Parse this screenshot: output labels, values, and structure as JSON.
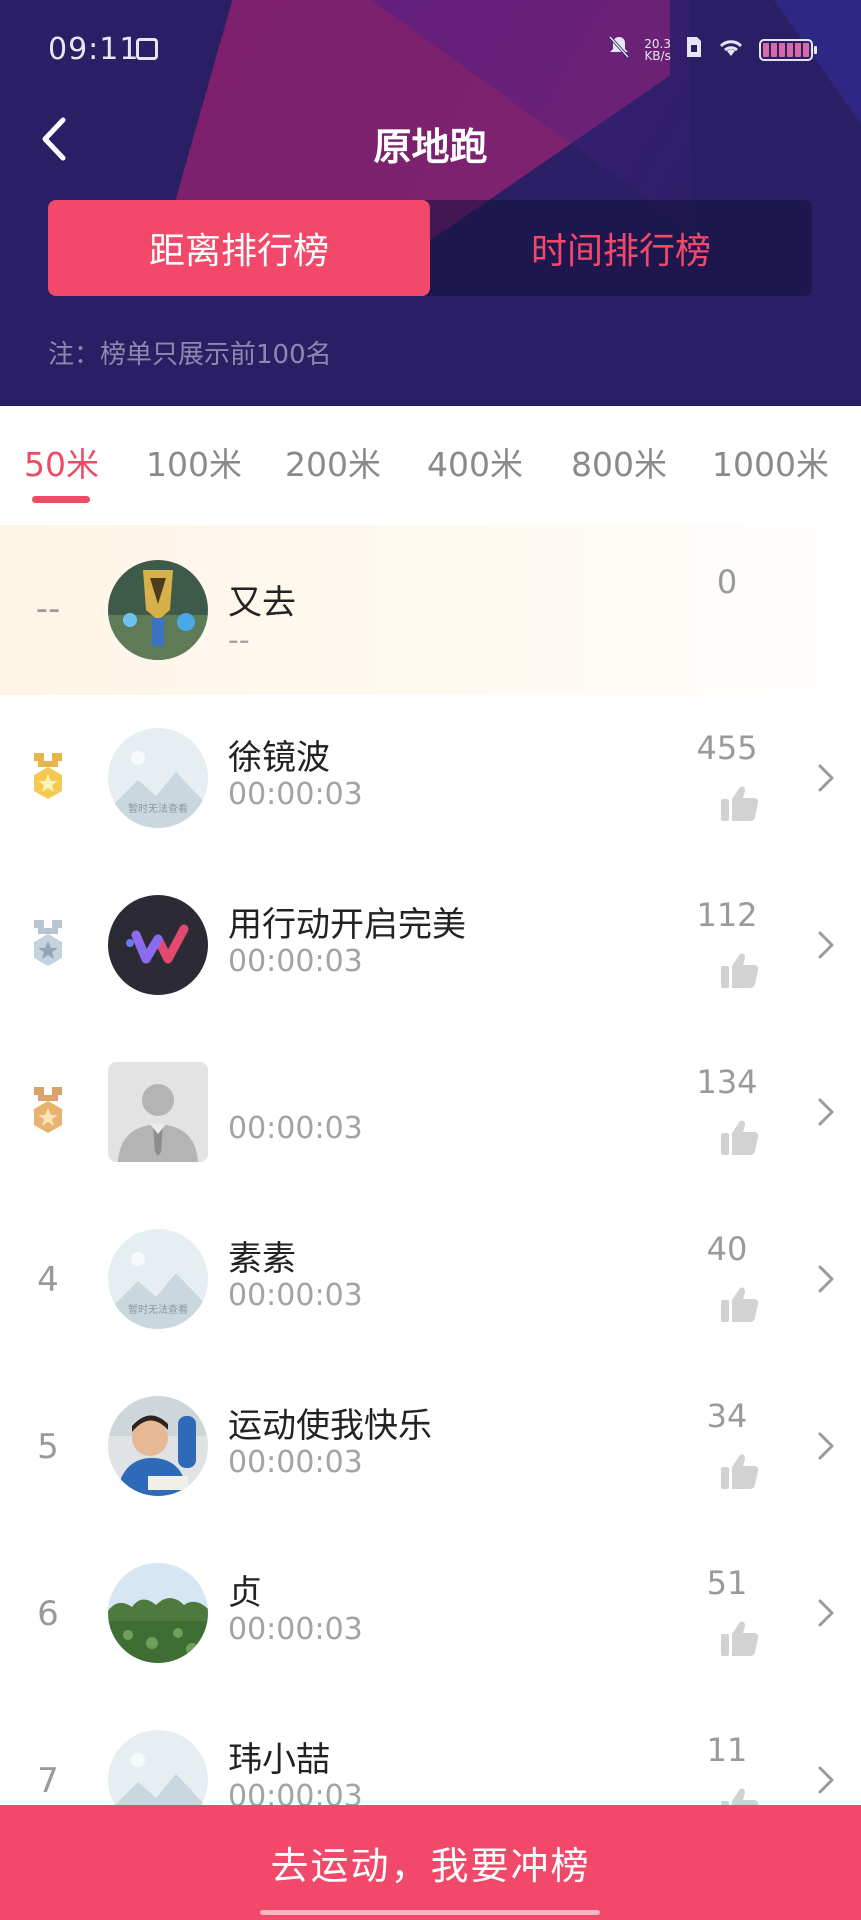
{
  "status_bar": {
    "time": "09:11",
    "net_speed_value": "20.3",
    "net_speed_unit": "KB/s"
  },
  "header": {
    "title": "原地跑",
    "tabs": [
      {
        "label": "距离排行榜",
        "active": true
      },
      {
        "label": "时间排行榜",
        "active": false
      }
    ],
    "note": "注：榜单只展示前100名"
  },
  "distance_tabs": [
    {
      "label": "50米",
      "active": true
    },
    {
      "label": "100米",
      "active": false
    },
    {
      "label": "200米",
      "active": false
    },
    {
      "label": "400米",
      "active": false
    },
    {
      "label": "800米",
      "active": false
    },
    {
      "label": "1000米",
      "active": false
    }
  ],
  "my_entry": {
    "rank": "--",
    "name": "又去",
    "time": "--",
    "likes": "0"
  },
  "rankings": [
    {
      "rank": "1",
      "medal": "gold",
      "name": "徐镜波",
      "time": "00:00:03",
      "likes": "455",
      "avatar": "placeholder",
      "avatar_caption": "暂时无法查看"
    },
    {
      "rank": "2",
      "medal": "silver",
      "name": "用行动开启完美",
      "time": "00:00:03",
      "likes": "112",
      "avatar": "logo-w"
    },
    {
      "rank": "3",
      "medal": "bronze",
      "name": "",
      "time": "00:00:03",
      "likes": "134",
      "avatar": "default-person"
    },
    {
      "rank": "4",
      "name": "素素",
      "time": "00:00:03",
      "likes": "40",
      "avatar": "placeholder",
      "avatar_caption": "暂时无法查看"
    },
    {
      "rank": "5",
      "name": "运动使我快乐",
      "time": "00:00:03",
      "likes": "34",
      "avatar": "photo-child"
    },
    {
      "rank": "6",
      "name": "贞",
      "time": "00:00:03",
      "likes": "51",
      "avatar": "photo-landscape"
    },
    {
      "rank": "7",
      "name": "玮小喆",
      "time": "00:00:03",
      "likes": "11",
      "avatar": "placeholder"
    }
  ],
  "cta": {
    "label": "去运动，我要冲榜"
  },
  "colors": {
    "accent": "#f2486a",
    "header_bg": "#2a1f64"
  }
}
